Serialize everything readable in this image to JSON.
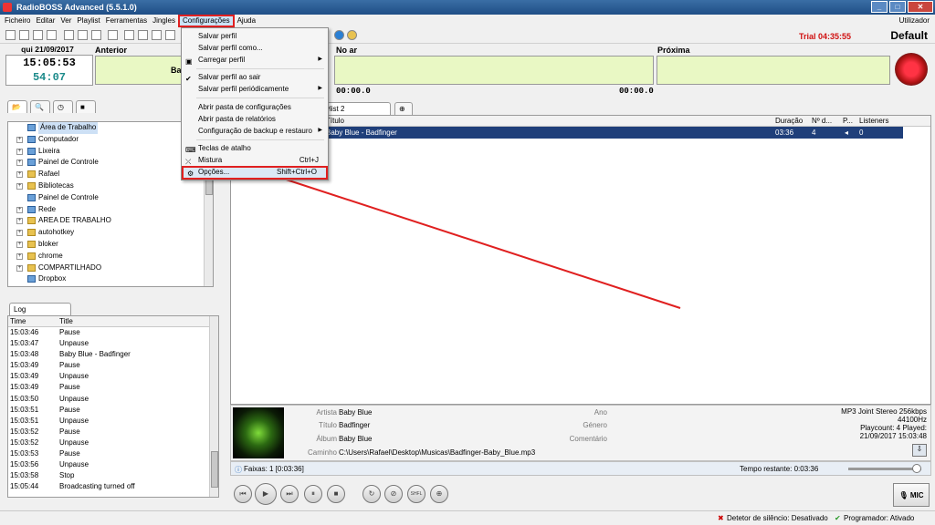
{
  "window": {
    "title": "RadioBOSS Advanced (5.5.1.0)",
    "controls": [
      "_",
      "□",
      "✕"
    ]
  },
  "menu": {
    "items": [
      "Ficheiro",
      "Editar",
      "Ver",
      "Playlist",
      "Ferramentas",
      "Jingles",
      "Configurações",
      "Ajuda"
    ],
    "right": "Utilizador"
  },
  "toolbar": {
    "trial": "Trial 04:35:55",
    "profile": "Default"
  },
  "clock": {
    "date": "qui 21/09/2017",
    "time": "15:05:53",
    "countdown": "54:07"
  },
  "panels": {
    "anterior_title": "Anterior",
    "anterior_text": "Bab",
    "noar_title": "No ar",
    "noar_left_time": "00:00.0",
    "noar_right_time": "00:00.0",
    "proxima_title": "Próxima"
  },
  "dropdown": {
    "items": [
      {
        "label": "Salvar perfil"
      },
      {
        "label": "Salvar perfil como..."
      },
      {
        "label": "Carregar perfil",
        "submenu": true
      },
      {
        "label": "Salvar perfil ao sair",
        "checked": true
      },
      {
        "label": "Salvar perfil periódicamente",
        "submenu": true
      },
      {
        "label": "Abrir pasta de configurações"
      },
      {
        "label": "Abrir pasta de relatórios"
      },
      {
        "label": "Configuração de backup e restauro",
        "submenu": true
      },
      {
        "label": "Teclas de atalho"
      },
      {
        "label": "Mistura",
        "shortcut": "Ctrl+J"
      },
      {
        "label": "Opções...",
        "shortcut": "Shift+Ctrl+O"
      }
    ]
  },
  "tree": {
    "items": [
      "Área de Trabalho",
      "Computador",
      "Lixeira",
      "Painel de Controle",
      "Rafael",
      "Bibliotecas",
      "Painel de Controle",
      "Rede",
      "AREA DE TRABALHO",
      "autohotkey",
      "bloker",
      "chrome",
      "COMPARTILHADO",
      "Dropbox"
    ]
  },
  "log": {
    "tab": "Log",
    "headers": {
      "time": "Time",
      "title": "Title"
    },
    "rows": [
      {
        "time": "15:03:46",
        "title": "Pause"
      },
      {
        "time": "15:03:47",
        "title": "Unpause"
      },
      {
        "time": "15:03:48",
        "title": "Baby Blue - Badfinger"
      },
      {
        "time": "15:03:49",
        "title": "Pause"
      },
      {
        "time": "15:03:49",
        "title": "Unpause"
      },
      {
        "time": "15:03:49",
        "title": "Pause"
      },
      {
        "time": "15:03:50",
        "title": "Unpause"
      },
      {
        "time": "15:03:51",
        "title": "Pause"
      },
      {
        "time": "15:03:51",
        "title": "Unpause"
      },
      {
        "time": "15:03:52",
        "title": "Pause"
      },
      {
        "time": "15:03:52",
        "title": "Unpause"
      },
      {
        "time": "15:03:53",
        "title": "Pause"
      },
      {
        "time": "15:03:56",
        "title": "Unpause"
      },
      {
        "time": "15:03:58",
        "title": "Stop"
      },
      {
        "time": "15:05:44",
        "title": "Broadcasting turned off"
      }
    ]
  },
  "playlist": {
    "tab": "ylist 2",
    "headers": {
      "title": "Título",
      "duration": "Duração",
      "number": "Nº d...",
      "p": "P...",
      "listeners": "Listeners"
    },
    "rows": [
      {
        "title": "Baby Blue - Badfinger",
        "duration": "03:36",
        "number": "4",
        "listeners": "0"
      }
    ]
  },
  "info": {
    "labels": {
      "artist": "Artista",
      "title": "Título",
      "album": "Álbum",
      "path": "Caminho",
      "year": "Ano",
      "genre": "Género",
      "comment": "Comentário"
    },
    "artist": "Baby Blue",
    "title": "Badfinger",
    "album": "Baby Blue",
    "path": "C:\\Users\\Rafael\\Desktop\\Musicas\\Badfinger-Baby_Blue.mp3",
    "format": "MP3 Joint Stereo 256kbps",
    "rate": "44100Hz",
    "playcount": "Playcount: 4  Played:",
    "played_at": "21/09/2017 15:03:48"
  },
  "faixas": {
    "label": "Faixas: 1 [0:03:36]",
    "remaining": "Tempo restante: 0:03:36"
  },
  "controls": {
    "shuffle": "SHFL",
    "mic": "MIC"
  },
  "status": {
    "silence": "Detetor de silêncio: Desativado",
    "scheduler": "Programador: Ativado"
  },
  "colors": {
    "highlight_red": "#e02020",
    "selected_row": "#1f3f7a",
    "panel_green": "#e9f8c4"
  }
}
